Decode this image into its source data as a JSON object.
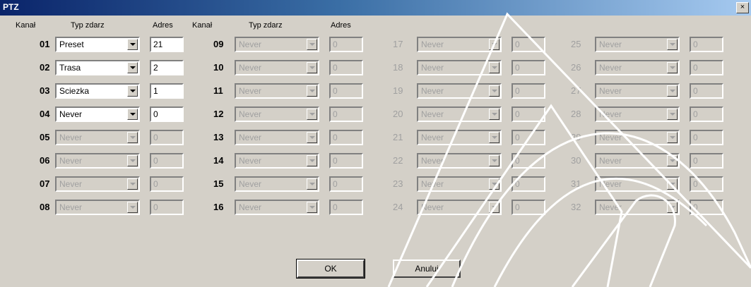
{
  "window": {
    "title": "PTZ",
    "close_label": "×"
  },
  "headers": {
    "kanal": "Kanał",
    "typ": "Typ zdarz",
    "adres": "Adres"
  },
  "channels": [
    {
      "num": "01",
      "type": "Preset",
      "addr": "21",
      "enabled": true
    },
    {
      "num": "02",
      "type": "Trasa",
      "addr": "2",
      "enabled": true
    },
    {
      "num": "03",
      "type": "Sciezka",
      "addr": "1",
      "enabled": true
    },
    {
      "num": "04",
      "type": "Never",
      "addr": "0",
      "enabled": true
    },
    {
      "num": "05",
      "type": "Never",
      "addr": "0",
      "enabled": false
    },
    {
      "num": "06",
      "type": "Never",
      "addr": "0",
      "enabled": false
    },
    {
      "num": "07",
      "type": "Never",
      "addr": "0",
      "enabled": false
    },
    {
      "num": "08",
      "type": "Never",
      "addr": "0",
      "enabled": false
    },
    {
      "num": "09",
      "type": "Never",
      "addr": "0",
      "enabled": false
    },
    {
      "num": "10",
      "type": "Never",
      "addr": "0",
      "enabled": false
    },
    {
      "num": "11",
      "type": "Never",
      "addr": "0",
      "enabled": false
    },
    {
      "num": "12",
      "type": "Never",
      "addr": "0",
      "enabled": false
    },
    {
      "num": "13",
      "type": "Never",
      "addr": "0",
      "enabled": false
    },
    {
      "num": "14",
      "type": "Never",
      "addr": "0",
      "enabled": false
    },
    {
      "num": "15",
      "type": "Never",
      "addr": "0",
      "enabled": false
    },
    {
      "num": "16",
      "type": "Never",
      "addr": "0",
      "enabled": false
    },
    {
      "num": "17",
      "type": "Never",
      "addr": "0",
      "enabled": false
    },
    {
      "num": "18",
      "type": "Never",
      "addr": "0",
      "enabled": false
    },
    {
      "num": "19",
      "type": "Never",
      "addr": "0",
      "enabled": false
    },
    {
      "num": "20",
      "type": "Never",
      "addr": "0",
      "enabled": false
    },
    {
      "num": "21",
      "type": "Never",
      "addr": "0",
      "enabled": false
    },
    {
      "num": "22",
      "type": "Never",
      "addr": "0",
      "enabled": false
    },
    {
      "num": "23",
      "type": "Never",
      "addr": "0",
      "enabled": false
    },
    {
      "num": "24",
      "type": "Never",
      "addr": "0",
      "enabled": false
    },
    {
      "num": "25",
      "type": "Never",
      "addr": "0",
      "enabled": false
    },
    {
      "num": "26",
      "type": "Never",
      "addr": "0",
      "enabled": false
    },
    {
      "num": "27",
      "type": "Never",
      "addr": "0",
      "enabled": false
    },
    {
      "num": "28",
      "type": "Never",
      "addr": "0",
      "enabled": false
    },
    {
      "num": "29",
      "type": "Never",
      "addr": "0",
      "enabled": false
    },
    {
      "num": "30",
      "type": "Never",
      "addr": "0",
      "enabled": false
    },
    {
      "num": "31",
      "type": "Never",
      "addr": "0",
      "enabled": false
    },
    {
      "num": "32",
      "type": "Never",
      "addr": "0",
      "enabled": false
    }
  ],
  "buttons": {
    "ok": "OK",
    "cancel": "Anuluj"
  }
}
